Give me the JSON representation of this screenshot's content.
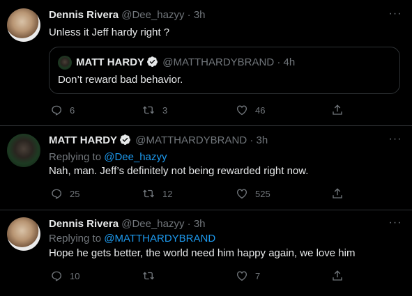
{
  "tweets": [
    {
      "name": "Dennis Rivera",
      "handle": "@Dee_hazyy",
      "time": "· 3h",
      "text": "Unless it Jeff hardy right ?",
      "quote": {
        "name": "MATT HARDY",
        "handle": "@MATTHARDYBRAND",
        "time": "· 4h",
        "text": "Don’t reward bad behavior."
      },
      "replies": "6",
      "retweets": "3",
      "likes": "46"
    },
    {
      "name": "MATT HARDY",
      "handle": "@MATTHARDYBRAND",
      "time": "· 3h",
      "replying_prefix": "Replying to",
      "replying_to": "@Dee_hazyy",
      "text": "Nah, man. Jeff’s definitely not being rewarded right now.",
      "replies": "25",
      "retweets": "12",
      "likes": "525"
    },
    {
      "name": "Dennis Rivera",
      "handle": "@Dee_hazyy",
      "time": "· 3h",
      "replying_prefix": "Replying to",
      "replying_to": "@MATTHARDYBRAND",
      "text": "Hope he gets better, the world need him happy again, we love him",
      "replies": "10",
      "retweets": "",
      "likes": "7"
    }
  ],
  "more_label": "···",
  "colors": {
    "background": "#000000",
    "text": "#e7e9ea",
    "muted": "#71767b",
    "accent": "#1d9bf0",
    "border": "#2f3336"
  },
  "icons": [
    "reply-icon",
    "retweet-icon",
    "like-icon",
    "share-icon",
    "verified-badge-icon",
    "more-icon"
  ]
}
